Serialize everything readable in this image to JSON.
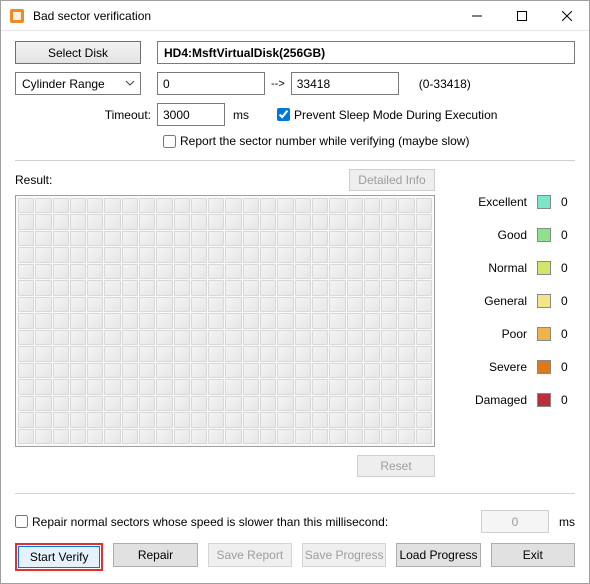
{
  "window": {
    "title": "Bad sector verification"
  },
  "toolbar": {
    "select_disk": "Select Disk",
    "disk": "HD4:MsftVirtualDisk(256GB)"
  },
  "range": {
    "mode": "Cylinder Range",
    "from": "0",
    "to": "33418",
    "hint": "(0-33418)"
  },
  "timeout": {
    "label": "Timeout:",
    "value": "3000",
    "unit": "ms",
    "prevent_sleep": "Prevent Sleep Mode During Execution",
    "report_sector": "Report the sector number while verifying (maybe slow)"
  },
  "result": {
    "label": "Result:",
    "detailed_info": "Detailed Info",
    "reset": "Reset"
  },
  "legend": {
    "items": [
      {
        "label": "Excellent",
        "color": "#7de6c7",
        "count": "0"
      },
      {
        "label": "Good",
        "color": "#8fe08f",
        "count": "0"
      },
      {
        "label": "Normal",
        "color": "#d4e36b",
        "count": "0"
      },
      {
        "label": "General",
        "color": "#f4e58a",
        "count": "0"
      },
      {
        "label": "Poor",
        "color": "#f0b24a",
        "count": "0"
      },
      {
        "label": "Severe",
        "color": "#db7a1c",
        "count": "0"
      },
      {
        "label": "Damaged",
        "color": "#b82e3a",
        "count": "0"
      }
    ]
  },
  "repair": {
    "text": "Repair normal sectors whose speed is slower than this millisecond:",
    "value": "0",
    "unit": "ms"
  },
  "buttons": {
    "start": "Start Verify",
    "repair": "Repair",
    "save_report": "Save Report",
    "save_progress": "Save Progress",
    "load_progress": "Load Progress",
    "exit": "Exit"
  }
}
